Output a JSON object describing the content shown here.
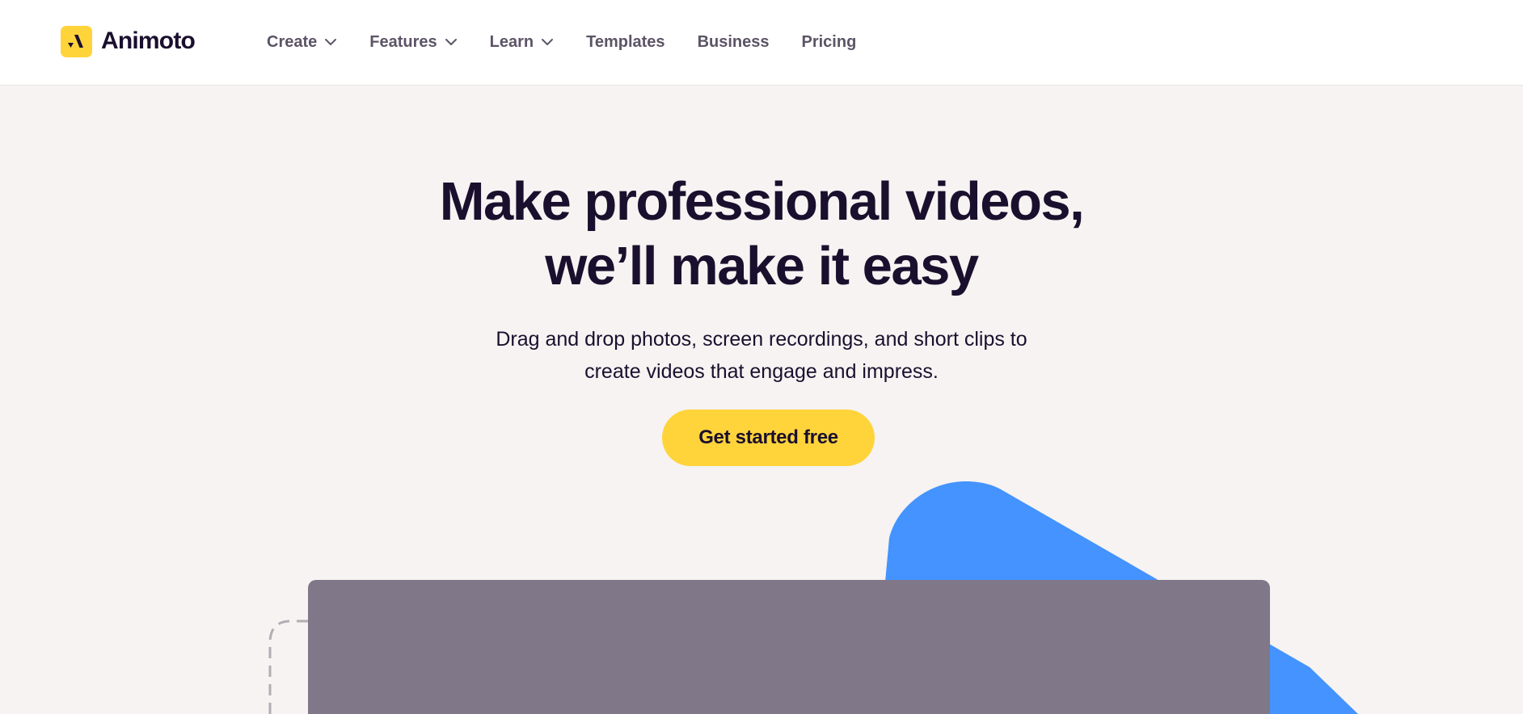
{
  "brand": {
    "name": "Animoto",
    "accent_color": "#ffd43b",
    "text_color": "#1b0f2e"
  },
  "nav": {
    "items": [
      {
        "label": "Create",
        "has_dropdown": true
      },
      {
        "label": "Features",
        "has_dropdown": true
      },
      {
        "label": "Learn",
        "has_dropdown": true
      },
      {
        "label": "Templates",
        "has_dropdown": false
      },
      {
        "label": "Business",
        "has_dropdown": false
      },
      {
        "label": "Pricing",
        "has_dropdown": false
      }
    ]
  },
  "hero": {
    "headline_line1": "Make professional videos,",
    "headline_line2": "we’ll make it easy",
    "subhead_line1": "Drag and drop photos, screen recordings, and short clips to",
    "subhead_line2": "create videos that engage and impress.",
    "cta_label": "Get started free",
    "background_color": "#f6f3f2",
    "shape_color": "#4493ff",
    "video_frame_color": "#807788"
  }
}
